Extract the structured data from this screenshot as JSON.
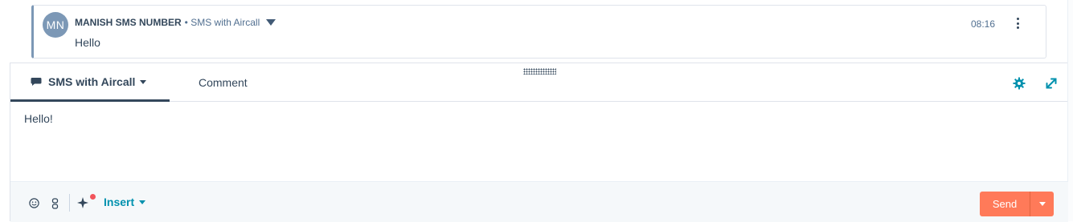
{
  "message": {
    "avatar_initials": "MN",
    "sender": "MANISH SMS NUMBER",
    "channel": "• SMS with Aircall",
    "body": "Hello",
    "time": "08:16"
  },
  "composer": {
    "tabs": [
      {
        "label": "SMS with Aircall",
        "active": true
      },
      {
        "label": "Comment",
        "active": false
      }
    ],
    "editor_text": "Hello!",
    "toolbar": {
      "insert_label": "Insert",
      "send_label": "Send"
    }
  },
  "colors": {
    "accent": "#ff7a59",
    "link": "#0091ae",
    "avatar": "#7c98b6",
    "notification_dot": "#f2545b"
  },
  "icons": [
    "chevron-down-icon",
    "more-vertical-icon",
    "chat-icon",
    "gear-icon",
    "expand-icon",
    "emoji-icon",
    "snippet-icon",
    "ai-sparkle-icon"
  ]
}
